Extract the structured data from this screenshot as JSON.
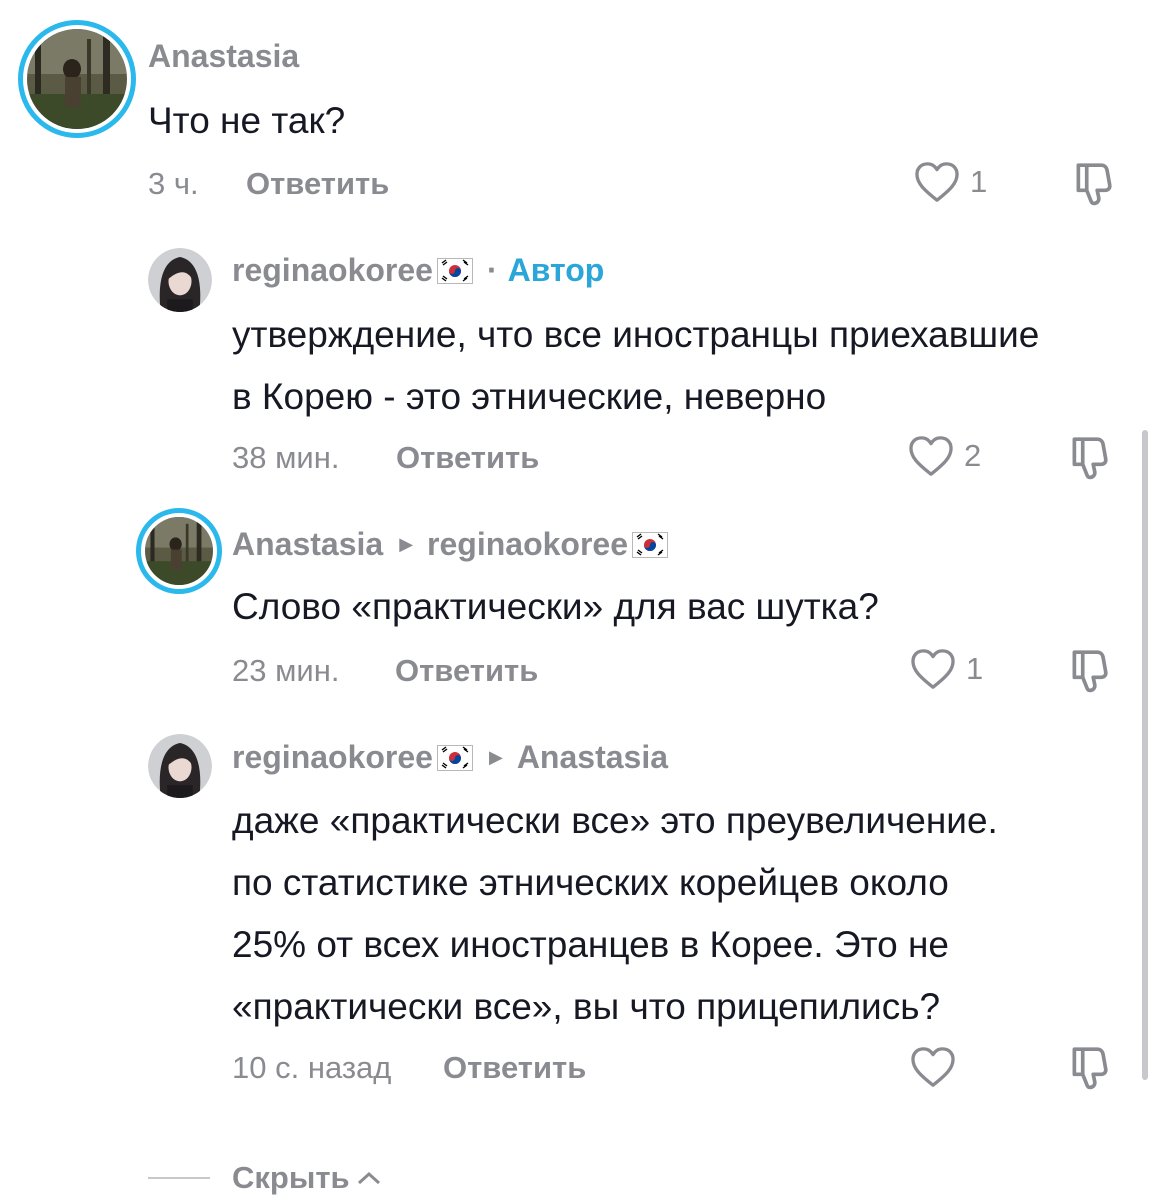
{
  "comments": [
    {
      "username": "Anastasia",
      "text": "Что не так?",
      "time": "3 ч.",
      "reply_label": "Ответить",
      "likes": "1"
    },
    {
      "username": "reginaokoree",
      "author_badge": "Автор",
      "text_lines": [
        "утверждение, что все иностранцы приехавшие",
        "в Корею - это этнические, неверно"
      ],
      "time": "38 мин.",
      "reply_label": "Ответить",
      "likes": "2"
    },
    {
      "username": "Anastasia",
      "reply_to": "reginaokoree",
      "text": "Слово «практически» для вас шутка?",
      "time": "23 мин.",
      "reply_label": "Ответить",
      "likes": "1"
    },
    {
      "username": "reginaokoree",
      "reply_to": "Anastasia",
      "text_lines": [
        "даже «практически все» это преувеличение.",
        "по статистике этнических корейцев около",
        "25% от всех иностранцев в Корее. Это не",
        "«практически все», вы что прицепились?"
      ],
      "time": "10 с. назад",
      "reply_label": "Ответить",
      "likes": ""
    }
  ],
  "footer": {
    "hide_label": "Скрыть"
  },
  "colors": {
    "accent": "#2aa6d8",
    "ring": "#2bb8ec",
    "muted": "#8a8b91",
    "text": "#161823"
  },
  "icons": [
    "heart-icon",
    "dislike-icon",
    "korea-flag-icon",
    "caret-right-icon",
    "chevron-up-icon"
  ]
}
